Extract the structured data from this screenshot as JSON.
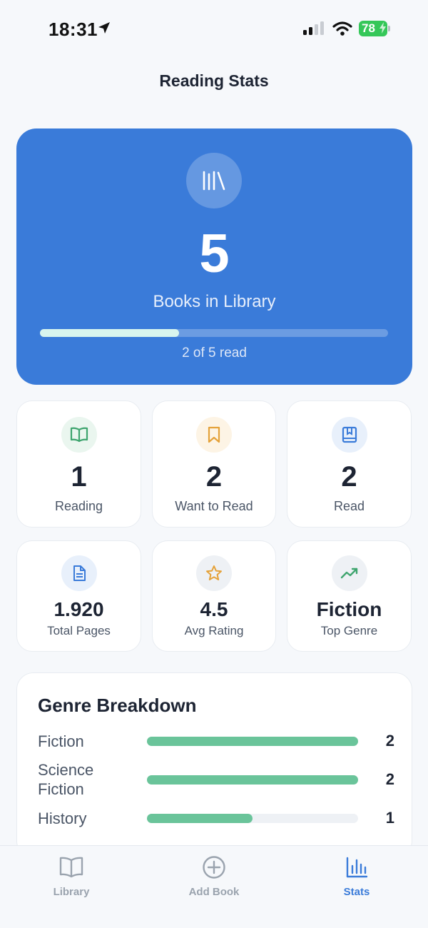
{
  "status_bar": {
    "time": "18:31",
    "battery": "78"
  },
  "header": {
    "title": "Reading Stats"
  },
  "hero": {
    "icon": "library-icon",
    "count": "5",
    "label": "Books in Library",
    "progress_fraction": 0.4,
    "progress_text": "2 of 5 read",
    "color": "#3a7bd9"
  },
  "status_cards": [
    {
      "icon": "book-open-icon",
      "value": "1",
      "label": "Reading",
      "color": "#3fa56f"
    },
    {
      "icon": "bookmark-icon",
      "value": "2",
      "label": "Want to Read",
      "color": "#e5a23a"
    },
    {
      "icon": "book-check-icon",
      "value": "2",
      "label": "Read",
      "color": "#3a7bd9"
    }
  ],
  "summary_cards": [
    {
      "icon": "document-icon",
      "value": "1.920",
      "label": "Total Pages",
      "color": "#3a7bd9"
    },
    {
      "icon": "star-icon",
      "value": "4.5",
      "label": "Avg Rating",
      "color": "#e5a23a"
    },
    {
      "icon": "trending-up-icon",
      "value": "Fiction",
      "label": "Top Genre",
      "color": "#3fa56f"
    }
  ],
  "genre_breakdown": {
    "title": "Genre Breakdown",
    "items": [
      {
        "name": "Fiction",
        "count": "2",
        "fraction": 1.0
      },
      {
        "name": "Science Fiction",
        "count": "2",
        "fraction": 1.0
      },
      {
        "name": "History",
        "count": "1",
        "fraction": 0.5
      }
    ],
    "bar_color": "#6ac49a"
  },
  "tab_bar": {
    "tabs": [
      {
        "label": "Library",
        "icon": "book-icon",
        "active": false
      },
      {
        "label": "Add Book",
        "icon": "plus-circle-icon",
        "active": false
      },
      {
        "label": "Stats",
        "icon": "bar-chart-icon",
        "active": true
      }
    ],
    "active_color": "#3a7bd9"
  }
}
